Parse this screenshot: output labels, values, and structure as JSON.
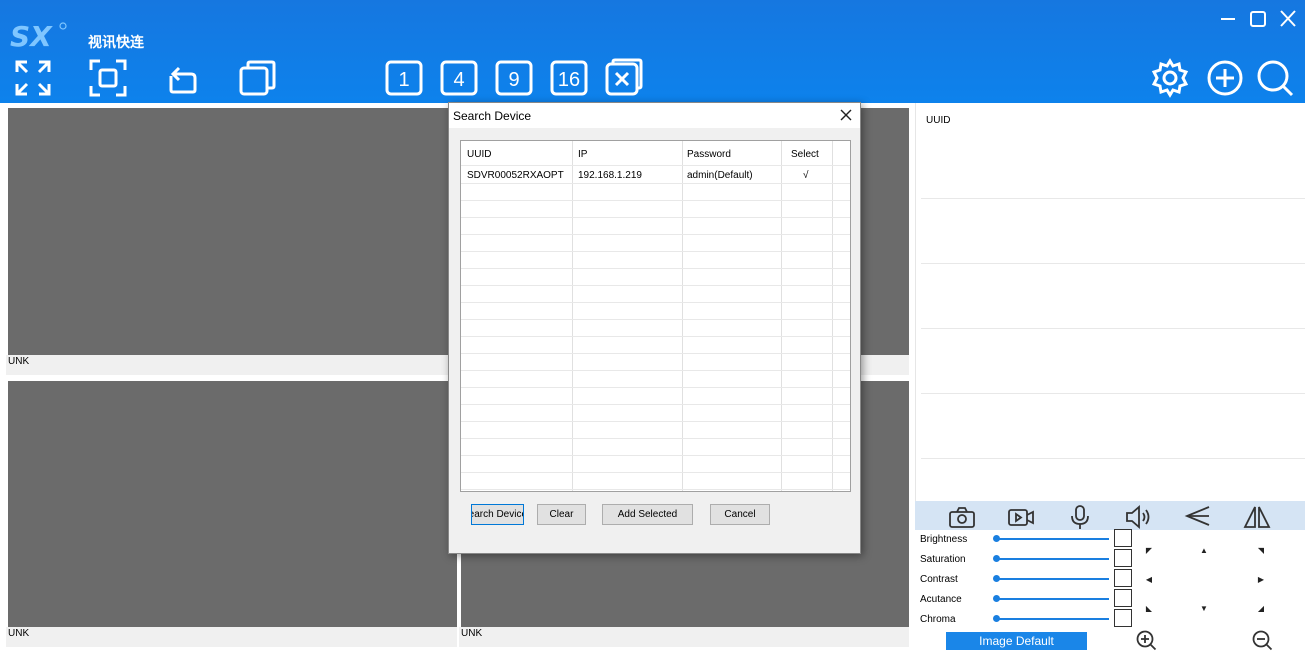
{
  "app": {
    "logo_text": "SX",
    "title": "视讯快连"
  },
  "toolbar": {
    "left_icons": [
      "fullscreen-icon",
      "fit-screen-icon",
      "rotate-icon",
      "multi-window-icon"
    ],
    "layouts": [
      "1",
      "4",
      "9",
      "16"
    ],
    "close_all_icon": "close-all-icon",
    "right_icons": [
      "settings-icon",
      "add-device-icon",
      "search-icon"
    ]
  },
  "window_controls": [
    "minimize-icon",
    "maximize-icon",
    "close-icon"
  ],
  "panes": [
    {
      "label": "UNK"
    },
    {
      "label": ""
    },
    {
      "label": "UNK"
    },
    {
      "label": "UNK"
    }
  ],
  "right_panel": {
    "uuid_header": "UUID"
  },
  "controls": {
    "bar_icons": [
      "snapshot-icon",
      "record-icon",
      "microphone-icon",
      "speaker-icon",
      "flip-vertical-icon",
      "mirror-icon"
    ],
    "sliders": [
      {
        "label": "Brightness",
        "value": 0
      },
      {
        "label": "Saturation",
        "value": 0
      },
      {
        "label": "Contrast",
        "value": 0
      },
      {
        "label": "Acutance",
        "value": 0
      },
      {
        "label": "Chroma",
        "value": 0
      }
    ],
    "image_default_label": "Image Default"
  },
  "dialog": {
    "title": "Search Device",
    "columns": [
      "UUID",
      "IP",
      "Password",
      "Select"
    ],
    "rows": [
      {
        "uuid": "SDVR00052RXAOPT",
        "ip": "192.168.1.219",
        "password": "admin(Default)",
        "select": "√"
      }
    ],
    "buttons": {
      "search": "Search Device",
      "clear": "Clear",
      "add_selected": "Add Selected",
      "cancel": "Cancel"
    }
  },
  "colors": {
    "toolbar_blue": "#1677e0",
    "pane_gray": "#6b6b6b",
    "accent": "#1a7fe0"
  }
}
